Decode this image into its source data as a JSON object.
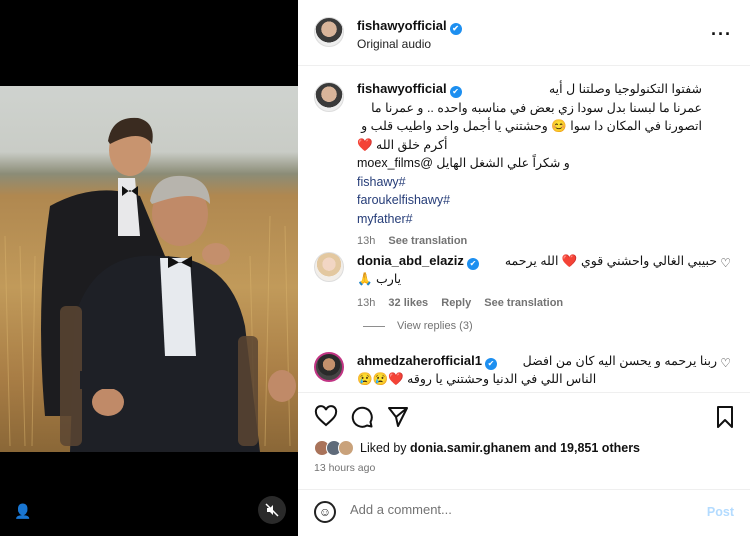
{
  "post": {
    "account": "fishawyofficial",
    "audio": "Original audio",
    "verified_mark": "✔"
  },
  "caption": {
    "username": "fishawyofficial",
    "lines": [
      "شفتوا التكنولوجيا وصلتنا ل أيه",
      "عمرنا ما لبسنا بدل سودا زي بعض في مناسبه واحده .. و عمرنا ما",
      "اتصورنا في المكان دا سوا 😊 وحشتني يا أجمل واحد واطيب قلب و",
      "أكرم خلق الله ❤️",
      "و شكراً علي الشغل الهايل @moex_films",
      "fishawy#",
      "faroukelfishawy#",
      "myfather#"
    ],
    "time": "13h",
    "see_translation": "See translation"
  },
  "comments": [
    {
      "username": "donia_abd_elaziz",
      "text": "حبيبي الغالي واحشني قوي ❤️ الله يرحمه",
      "text2": "يارب 🙏",
      "time": "13h",
      "likes": "32 likes",
      "reply": "Reply",
      "see_translation": "See translation",
      "view_replies": "View replies (3)"
    },
    {
      "username": "ahmedzaherofficial1",
      "text": "ربنا يرحمه و يحسن اليه كان من افضل",
      "text2": "الناس اللي في الدنيا وحشتني يا روقه ❤️😢😢"
    }
  ],
  "likes": {
    "prefix": "Liked by",
    "user": "donia.samir.ghanem",
    "suffix": "and 19,851 others"
  },
  "time_ago": "13 hours ago",
  "add_comment": {
    "placeholder": "Add a comment...",
    "post_label": "Post"
  },
  "icons": {
    "more": "more-icon",
    "heart": "heart-icon",
    "comment": "comment-icon",
    "share": "share-icon",
    "save": "bookmark-icon",
    "emoji": "emoji-icon",
    "mute": "mute-icon",
    "tagged": "person-icon"
  },
  "colors": {
    "verified": "#1d8ff0",
    "link": "#263d78",
    "muted_text": "#737373",
    "post_button": "#b3dbff"
  }
}
